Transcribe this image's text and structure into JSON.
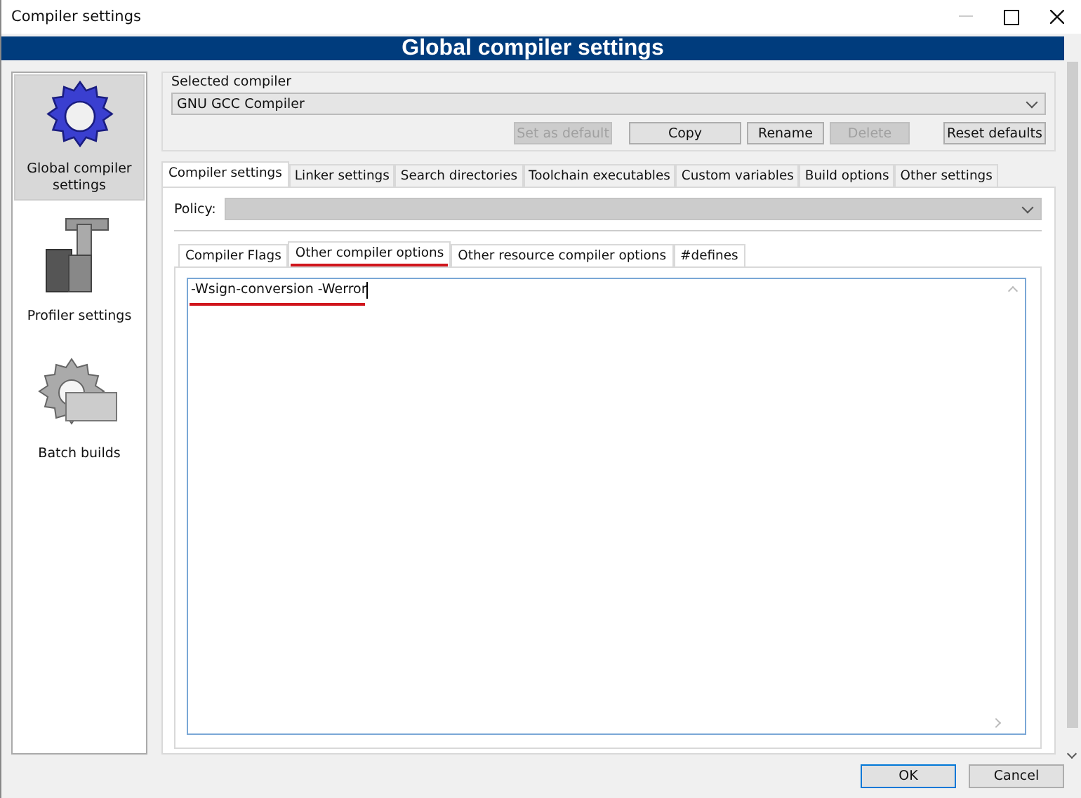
{
  "window": {
    "title": "Compiler settings"
  },
  "header": {
    "title": "Global compiler settings"
  },
  "sidebar": {
    "items": [
      {
        "label": "Global compiler settings",
        "kind": "global",
        "selected": true
      },
      {
        "label": "Profiler settings",
        "kind": "profiler",
        "selected": false
      },
      {
        "label": "Batch builds",
        "kind": "batch",
        "selected": false
      }
    ]
  },
  "selected_compiler": {
    "label": "Selected compiler",
    "value": "GNU GCC Compiler"
  },
  "compiler_buttons": [
    {
      "label": "Set as default",
      "disabled": true
    },
    {
      "label": "Copy",
      "disabled": false
    },
    {
      "label": "Rename",
      "disabled": false
    },
    {
      "label": "Delete",
      "disabled": true
    },
    {
      "label": "Reset defaults",
      "disabled": false
    }
  ],
  "tabs": [
    {
      "label": "Compiler settings",
      "selected": true
    },
    {
      "label": "Linker settings",
      "selected": false
    },
    {
      "label": "Search directories",
      "selected": false
    },
    {
      "label": "Toolchain executables",
      "selected": false
    },
    {
      "label": "Custom variables",
      "selected": false
    },
    {
      "label": "Build options",
      "selected": false
    },
    {
      "label": "Other settings",
      "selected": false
    }
  ],
  "policy": {
    "label": "Policy:",
    "disabled": true
  },
  "subtabs": [
    {
      "label": "Compiler Flags",
      "selected": false,
      "underlined": false
    },
    {
      "label": "Other compiler options",
      "selected": true,
      "underlined": true
    },
    {
      "label": "Other resource compiler options",
      "selected": false,
      "underlined": false
    },
    {
      "label": "#defines",
      "selected": false,
      "underlined": false
    }
  ],
  "options_editor": {
    "value": "-Wsign-conversion -Werror",
    "underlined": true
  },
  "buttons": [
    {
      "label": "OK",
      "default": true
    },
    {
      "label": "Cancel",
      "default": false
    }
  ]
}
